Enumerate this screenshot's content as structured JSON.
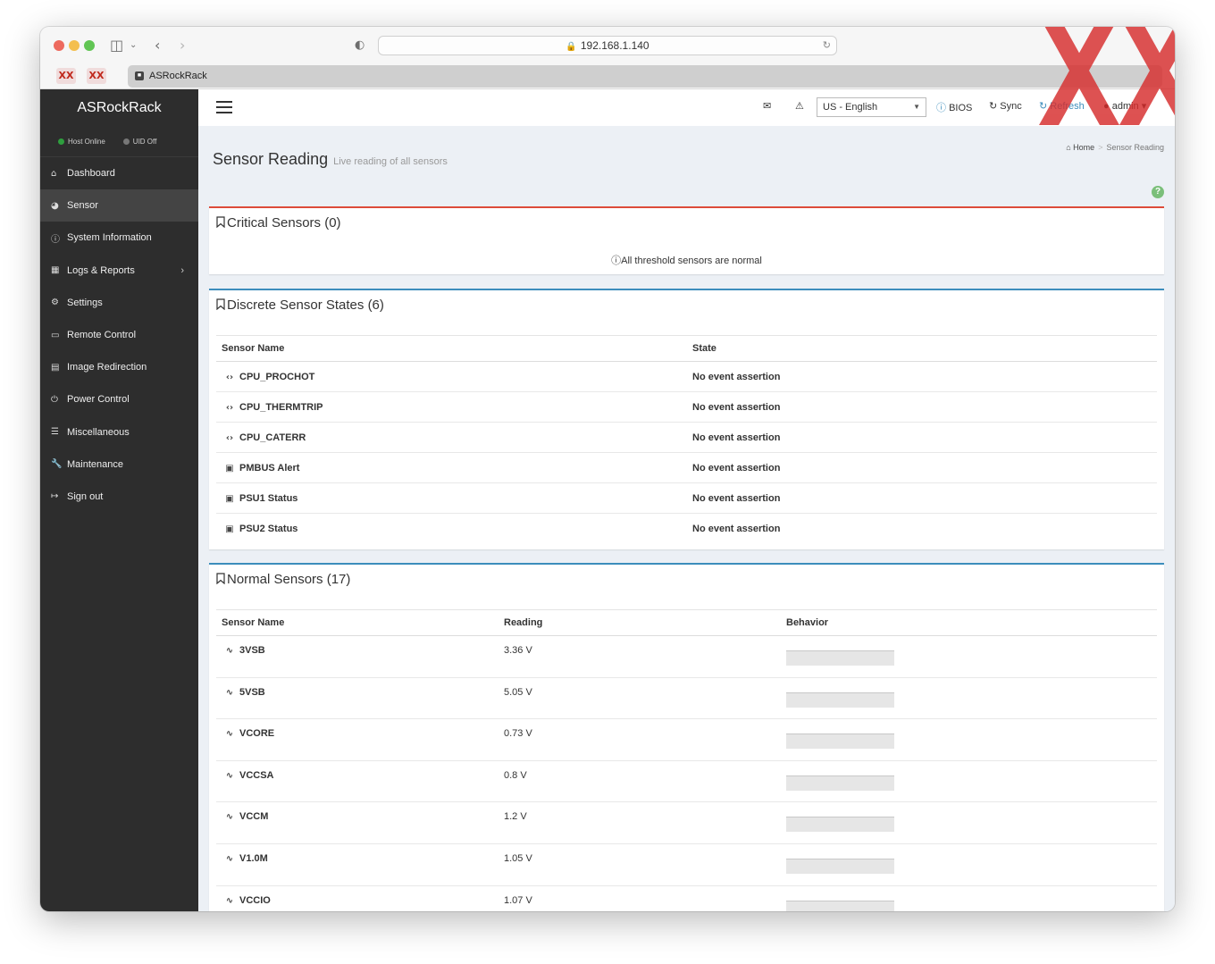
{
  "browser": {
    "url": "192.168.1.140",
    "tab_title": "ASRockRack",
    "favicon_labels": [
      "XX",
      "XX"
    ]
  },
  "sidebar": {
    "brand": "ASRockRack",
    "host_status": "Host Online",
    "uid_status": "UID Off",
    "items": [
      {
        "label": "Dashboard",
        "icon": "home-icon"
      },
      {
        "label": "Sensor",
        "icon": "dashboard-gauge-icon",
        "active": true
      },
      {
        "label": "System Information",
        "icon": "info-circle-icon"
      },
      {
        "label": "Logs & Reports",
        "icon": "bar-chart-icon",
        "has_submenu": true
      },
      {
        "label": "Settings",
        "icon": "gear-icon"
      },
      {
        "label": "Remote Control",
        "icon": "desktop-icon"
      },
      {
        "label": "Image Redirection",
        "icon": "hdd-icon"
      },
      {
        "label": "Power Control",
        "icon": "power-icon"
      },
      {
        "label": "Miscellaneous",
        "icon": "list-icon"
      },
      {
        "label": "Maintenance",
        "icon": "wrench-icon"
      },
      {
        "label": "Sign out",
        "icon": "sign-out-icon"
      }
    ]
  },
  "topnav": {
    "language": "US - English",
    "bios_label": "BIOS",
    "sync_label": "Sync",
    "refresh_label": "Refresh",
    "user_label": "admin"
  },
  "page": {
    "title": "Sensor Reading",
    "subtitle": "Live reading of all sensors",
    "breadcrumb_home": "Home",
    "breadcrumb_current": "Sensor Reading",
    "help_label": "?"
  },
  "critical": {
    "title": "Critical Sensors (0)",
    "message": "All threshold sensors are normal"
  },
  "discrete": {
    "title": "Discrete Sensor States (6)",
    "columns": [
      "Sensor Name",
      "State"
    ],
    "rows": [
      {
        "name": "CPU_PROCHOT",
        "state": "No event assertion",
        "icon": "code-arrows-icon"
      },
      {
        "name": "CPU_THERMTRIP",
        "state": "No event assertion",
        "icon": "code-arrows-icon"
      },
      {
        "name": "CPU_CATERR",
        "state": "No event assertion",
        "icon": "code-arrows-icon"
      },
      {
        "name": "PMBUS Alert",
        "state": "No event assertion",
        "icon": "power-plug-icon"
      },
      {
        "name": "PSU1 Status",
        "state": "No event assertion",
        "icon": "power-plug-icon"
      },
      {
        "name": "PSU2 Status",
        "state": "No event assertion",
        "icon": "power-plug-icon"
      }
    ]
  },
  "normal": {
    "title": "Normal Sensors (17)",
    "columns": [
      "Sensor Name",
      "Reading",
      "Behavior"
    ],
    "rows": [
      {
        "name": "3VSB",
        "reading": "3.36 V"
      },
      {
        "name": "5VSB",
        "reading": "5.05 V"
      },
      {
        "name": "VCORE",
        "reading": "0.73 V"
      },
      {
        "name": "VCCSA",
        "reading": "0.8 V"
      },
      {
        "name": "VCCM",
        "reading": "1.2 V"
      },
      {
        "name": "V1.0M",
        "reading": "1.05 V"
      },
      {
        "name": "VCCIO",
        "reading": "1.07 V"
      }
    ]
  },
  "colors": {
    "sidebar_bg": "#2d2d2d",
    "critical_border": "#dd4b39",
    "primary_border": "#3c8dbc",
    "status_green": "#2e9e3e",
    "help_green": "#7bbf7a",
    "info_blue": "#3c8dbc"
  }
}
